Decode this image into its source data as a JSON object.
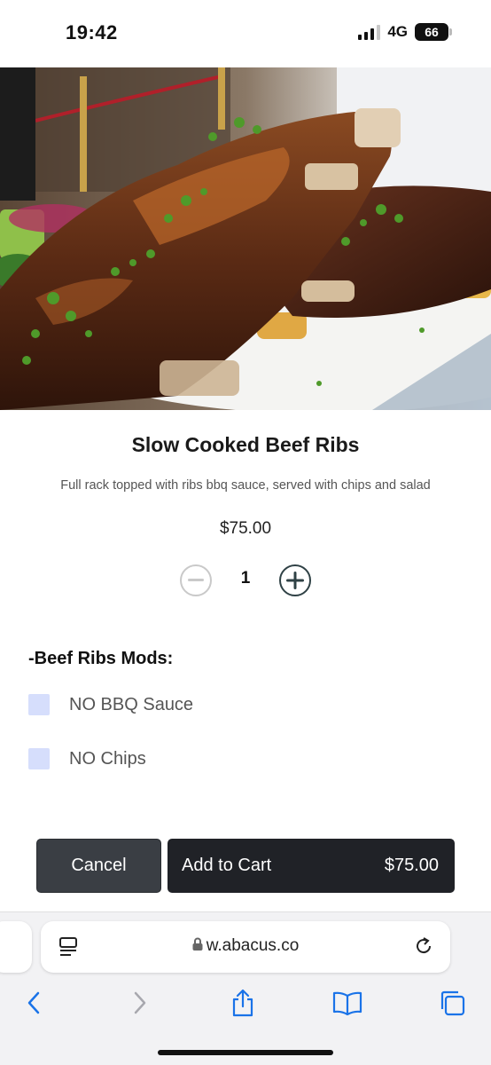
{
  "status": {
    "time": "19:42",
    "network": "4G",
    "battery": "66"
  },
  "product": {
    "title": "Slow Cooked Beef Ribs",
    "description": "Full rack topped with ribs bbq sauce, served with chips and salad",
    "price": "$75.00",
    "quantity": "1"
  },
  "mods": {
    "title": "-Beef Ribs Mods:",
    "options": [
      {
        "label": "NO BBQ Sauce",
        "checked": false
      },
      {
        "label": "NO Chips",
        "checked": false
      }
    ]
  },
  "actions": {
    "cancel": "Cancel",
    "add_to_cart": "Add to Cart",
    "add_to_cart_price": "$75.00"
  },
  "browser": {
    "url": "w.abacus.co"
  },
  "colors": {
    "checkbox": "#d6defc",
    "cancel_bg": "#3a3e44",
    "add_bg": "#202227",
    "ios_blue": "#1a73e8",
    "plus_stroke": "#2f4145"
  },
  "icons": [
    "minus-circle-icon",
    "plus-circle-icon",
    "lock-icon",
    "reader-icon",
    "reload-icon",
    "back-icon",
    "forward-icon",
    "share-icon",
    "bookmarks-icon",
    "tabs-icon"
  ]
}
